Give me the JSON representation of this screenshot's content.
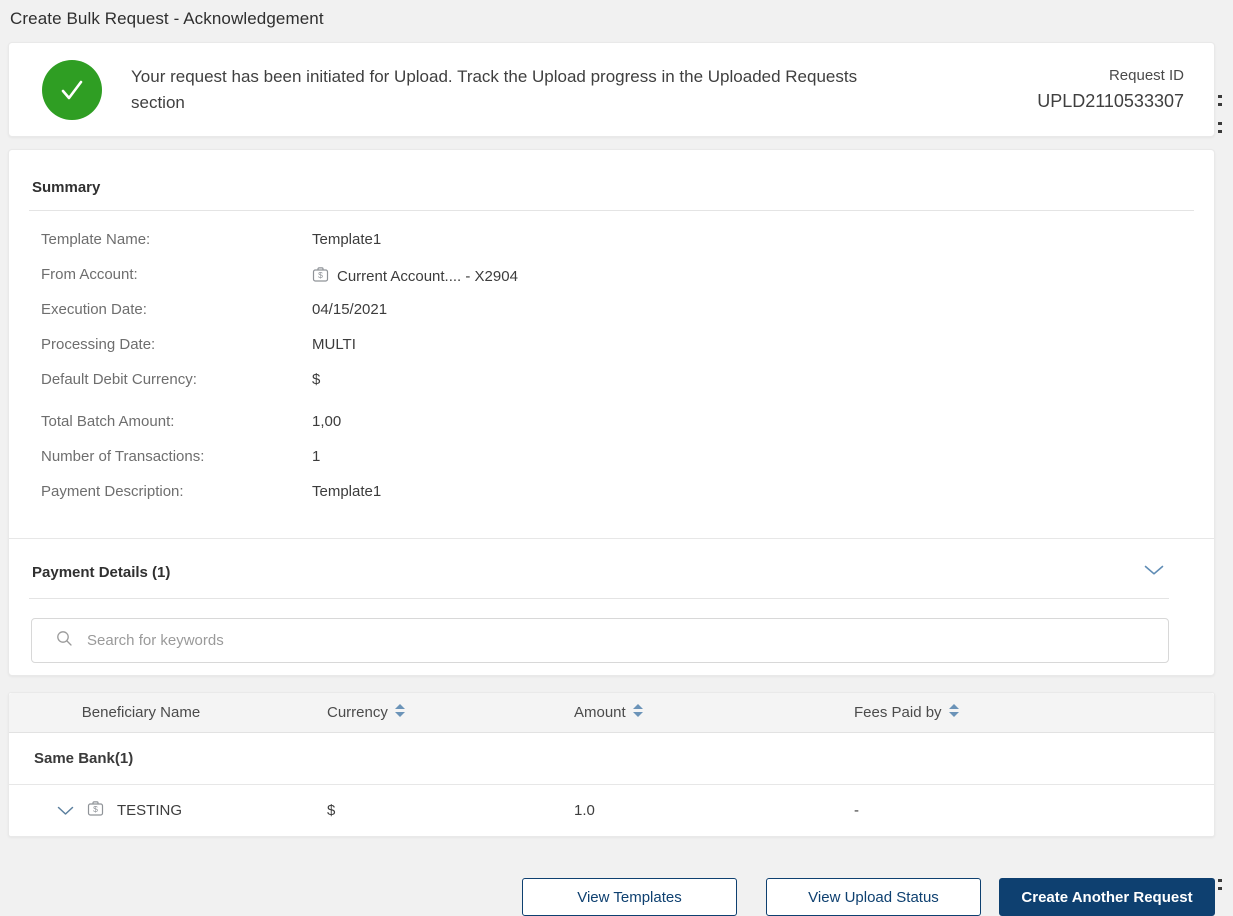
{
  "page": {
    "title": "Create Bulk Request - Acknowledgement"
  },
  "acknowledgement": {
    "message": "Your request has been initiated for Upload. Track the Upload progress in the Uploaded Requests section",
    "request_id_label": "Request ID",
    "request_id": "UPLD2110533307"
  },
  "summary": {
    "heading": "Summary",
    "rows": [
      {
        "label": "Template Name:",
        "value": "Template1"
      },
      {
        "label": "From Account:",
        "value": "Current Account.... - X2904"
      },
      {
        "label": "Execution Date:",
        "value": "04/15/2021"
      },
      {
        "label": "Processing Date:",
        "value": "MULTI"
      },
      {
        "label": "Default Debit Currency:",
        "value": "$"
      },
      {
        "label": "Total Batch Amount:",
        "value": "1,00"
      },
      {
        "label": "Number of Transactions:",
        "value": "1"
      },
      {
        "label": "Payment Description:",
        "value": "Template1"
      }
    ]
  },
  "payment_details": {
    "heading": "Payment Details (1)",
    "search": {
      "placeholder": "Search for keywords"
    }
  },
  "table": {
    "columns": [
      {
        "label": "Beneficiary Name"
      },
      {
        "label": "Currency"
      },
      {
        "label": "Amount"
      },
      {
        "label": "Fees Paid by"
      }
    ],
    "group_label": "Same Bank(1)",
    "rows": [
      {
        "beneficiary": "TESTING",
        "currency": "$",
        "amount": "1.0",
        "fees_paid_by": "-"
      }
    ]
  },
  "footer": {
    "buttons": [
      {
        "label": "View Templates"
      },
      {
        "label": "View Upload Status"
      },
      {
        "label": "Create Another Request"
      }
    ]
  },
  "colors": {
    "success_green": "#2f9e23",
    "primary_navy": "#0e4070",
    "accent_blue": "#6b93b8",
    "page_background": "#f1f1f1"
  }
}
